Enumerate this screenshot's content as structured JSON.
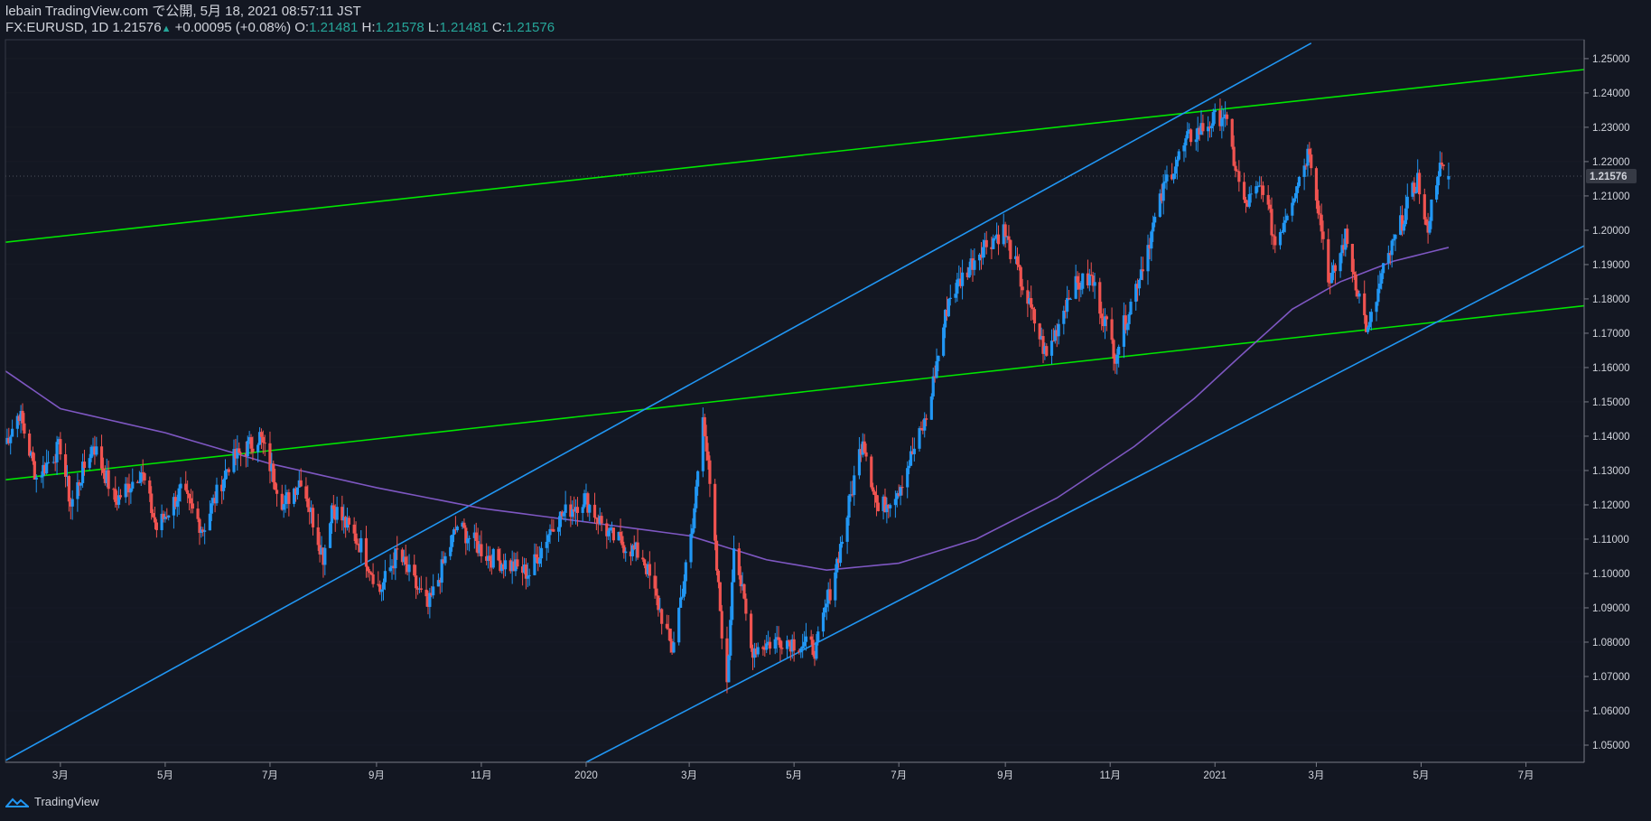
{
  "header": {
    "line1": "lebain TradingView.com で公開, 5月 18, 2021 08:57:11 JST",
    "symbol": "FX:EURUSD, 1D",
    "last": "1.21576",
    "change": "+0.00095 (+0.08%)",
    "o_label": "O:",
    "o_val": "1.21481",
    "h_label": "H:",
    "h_val": "1.21578",
    "l_label": "L:",
    "l_val": "1.21481",
    "c_label": "C:",
    "c_val": "1.21576"
  },
  "footer": {
    "brand": "TradingView"
  },
  "colors": {
    "up": "#2196f3",
    "down": "#ef5350",
    "green_line": "#00e600",
    "blue_line": "#2196f3",
    "ma": "#7e57c2",
    "grid": "#2a2e39",
    "price_tag": "#363a45"
  },
  "chart_data": {
    "type": "candlestick",
    "symbol": "FX:EURUSD",
    "interval": "1D",
    "y_axis": {
      "range": [
        1.045,
        1.2555
      ],
      "ticks": [
        "1.25000",
        "1.24000",
        "1.23000",
        "1.22000",
        "1.21000",
        "1.20000",
        "1.19000",
        "1.18000",
        "1.17000",
        "1.16000",
        "1.15000",
        "1.14000",
        "1.13000",
        "1.12000",
        "1.11000",
        "1.10000",
        "1.09000",
        "1.08000",
        "1.07000",
        "1.06000",
        "1.05000"
      ],
      "current": "1.21576"
    },
    "x_axis": {
      "ticks": [
        "3月",
        "5月",
        "7月",
        "9月",
        "11月",
        "2020",
        "3月",
        "5月",
        "7月",
        "9月",
        "11月",
        "2021",
        "3月",
        "5月",
        "7月"
      ]
    },
    "price_path": [
      {
        "d": "2019-01-28",
        "p": 1.138
      },
      {
        "d": "2019-02-05",
        "p": 1.147
      },
      {
        "d": "2019-02-15",
        "p": 1.128
      },
      {
        "d": "2019-03-01",
        "p": 1.137
      },
      {
        "d": "2019-03-07",
        "p": 1.12
      },
      {
        "d": "2019-03-20",
        "p": 1.138
      },
      {
        "d": "2019-04-02",
        "p": 1.121
      },
      {
        "d": "2019-04-17",
        "p": 1.13
      },
      {
        "d": "2019-04-26",
        "p": 1.113
      },
      {
        "d": "2019-05-10",
        "p": 1.124
      },
      {
        "d": "2019-05-23",
        "p": 1.113
      },
      {
        "d": "2019-06-07",
        "p": 1.132
      },
      {
        "d": "2019-06-25",
        "p": 1.14
      },
      {
        "d": "2019-07-09",
        "p": 1.12
      },
      {
        "d": "2019-07-19",
        "p": 1.128
      },
      {
        "d": "2019-08-01",
        "p": 1.105
      },
      {
        "d": "2019-08-06",
        "p": 1.12
      },
      {
        "d": "2019-08-23",
        "p": 1.108
      },
      {
        "d": "2019-09-03",
        "p": 1.095
      },
      {
        "d": "2019-09-13",
        "p": 1.106
      },
      {
        "d": "2019-10-01",
        "p": 1.09
      },
      {
        "d": "2019-10-18",
        "p": 1.114
      },
      {
        "d": "2019-11-05",
        "p": 1.105
      },
      {
        "d": "2019-11-29",
        "p": 1.1
      },
      {
        "d": "2019-12-13",
        "p": 1.115
      },
      {
        "d": "2019-12-31",
        "p": 1.122
      },
      {
        "d": "2020-01-15",
        "p": 1.111
      },
      {
        "d": "2020-02-03",
        "p": 1.105
      },
      {
        "d": "2020-02-20",
        "p": 1.078
      },
      {
        "d": "2020-03-03",
        "p": 1.113
      },
      {
        "d": "2020-03-09",
        "p": 1.148
      },
      {
        "d": "2020-03-23",
        "p": 1.066
      },
      {
        "d": "2020-03-27",
        "p": 1.11
      },
      {
        "d": "2020-04-06",
        "p": 1.078
      },
      {
        "d": "2020-04-24",
        "p": 1.081
      },
      {
        "d": "2020-05-14",
        "p": 1.078
      },
      {
        "d": "2020-05-29",
        "p": 1.11
      },
      {
        "d": "2020-06-10",
        "p": 1.14
      },
      {
        "d": "2020-06-19",
        "p": 1.118
      },
      {
        "d": "2020-07-01",
        "p": 1.125
      },
      {
        "d": "2020-07-17",
        "p": 1.145
      },
      {
        "d": "2020-07-30",
        "p": 1.18
      },
      {
        "d": "2020-08-18",
        "p": 1.195
      },
      {
        "d": "2020-08-31",
        "p": 1.2
      },
      {
        "d": "2020-09-25",
        "p": 1.163
      },
      {
        "d": "2020-10-09",
        "p": 1.183
      },
      {
        "d": "2020-10-21",
        "p": 1.186
      },
      {
        "d": "2020-11-04",
        "p": 1.164
      },
      {
        "d": "2020-11-18",
        "p": 1.187
      },
      {
        "d": "2020-12-04",
        "p": 1.215
      },
      {
        "d": "2020-12-17",
        "p": 1.227
      },
      {
        "d": "2021-01-06",
        "p": 1.234
      },
      {
        "d": "2021-01-18",
        "p": 1.207
      },
      {
        "d": "2021-01-29",
        "p": 1.213
      },
      {
        "d": "2021-02-05",
        "p": 1.196
      },
      {
        "d": "2021-02-25",
        "p": 1.224
      },
      {
        "d": "2021-03-09",
        "p": 1.184
      },
      {
        "d": "2021-03-18",
        "p": 1.198
      },
      {
        "d": "2021-03-31",
        "p": 1.17
      },
      {
        "d": "2021-04-09",
        "p": 1.188
      },
      {
        "d": "2021-04-29",
        "p": 1.215
      },
      {
        "d": "2021-05-04",
        "p": 1.199
      },
      {
        "d": "2021-05-11",
        "p": 1.218
      },
      {
        "d": "2021-05-17",
        "p": 1.21576
      }
    ],
    "moving_average": [
      {
        "d": "2019-01-28",
        "v": 1.159
      },
      {
        "d": "2019-03-01",
        "v": 1.148
      },
      {
        "d": "2019-05-01",
        "v": 1.141
      },
      {
        "d": "2019-07-01",
        "v": 1.132
      },
      {
        "d": "2019-09-01",
        "v": 1.125
      },
      {
        "d": "2019-11-01",
        "v": 1.119
      },
      {
        "d": "2020-01-01",
        "v": 1.115
      },
      {
        "d": "2020-03-01",
        "v": 1.111
      },
      {
        "d": "2020-04-15",
        "v": 1.104
      },
      {
        "d": "2020-05-20",
        "v": 1.101
      },
      {
        "d": "2020-07-01",
        "v": 1.103
      },
      {
        "d": "2020-08-15",
        "v": 1.11
      },
      {
        "d": "2020-10-01",
        "v": 1.122
      },
      {
        "d": "2020-11-15",
        "v": 1.137
      },
      {
        "d": "2020-12-20",
        "v": 1.151
      },
      {
        "d": "2021-01-15",
        "v": 1.163
      },
      {
        "d": "2021-02-15",
        "v": 1.177
      },
      {
        "d": "2021-03-15",
        "v": 1.185
      },
      {
        "d": "2021-04-15",
        "v": 1.191
      },
      {
        "d": "2021-05-17",
        "v": 1.195
      }
    ],
    "trend_lines": [
      {
        "name": "green-upper",
        "color": "#00e600",
        "from": {
          "d": "2019-01-28",
          "p": 1.1965
        },
        "to": {
          "d": "2021-08-31",
          "p": 1.2483
        }
      },
      {
        "name": "green-lower",
        "color": "#00e600",
        "from": {
          "d": "2019-01-28",
          "p": 1.1273
        },
        "to": {
          "d": "2021-08-31",
          "p": 1.1795
        }
      },
      {
        "name": "blue-upper",
        "color": "#2196f3",
        "from": {
          "d": "2019-01-28",
          "p": 1.0455
        },
        "to": {
          "d": "2021-02-26",
          "p": 1.2545
        }
      },
      {
        "name": "blue-lower",
        "color": "#2196f3",
        "from": {
          "d": "2020-01-01",
          "p": 1.045
        },
        "to": {
          "d": "2021-08-31",
          "p": 1.2025
        }
      }
    ]
  }
}
